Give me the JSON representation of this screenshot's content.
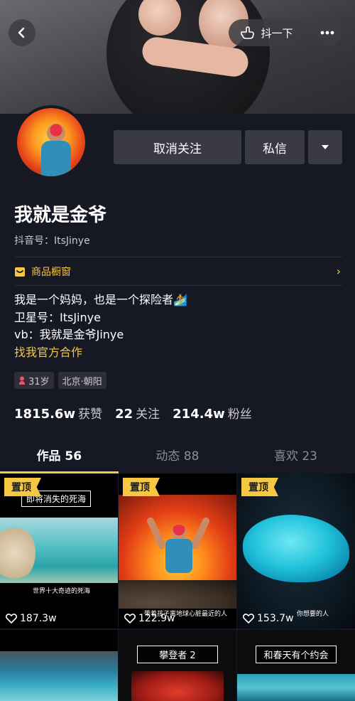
{
  "header": {
    "shake_label": "抖一下"
  },
  "profile": {
    "name": "我就是金爷",
    "douyin_id": "抖音号：ItsJinye",
    "unfollow_label": "取消关注",
    "message_label": "私信"
  },
  "shop": {
    "label": "商品橱窗"
  },
  "bio": {
    "line1": "我是一个妈妈，也是一个探险者🏄",
    "line2": "卫星号：ItsJinye",
    "line3": "vb：我就是金爷Jinye",
    "link": "找我官方合作"
  },
  "tags": {
    "age": "31岁",
    "location": "北京·朝阳"
  },
  "stats": {
    "likes_num": "1815.6w",
    "likes_label": "获赞",
    "following_num": "22",
    "following_label": "关注",
    "followers_num": "214.4w",
    "followers_label": "粉丝"
  },
  "tabs": [
    {
      "label": "作品 56"
    },
    {
      "label": "动态 88"
    },
    {
      "label": "喜欢 23"
    }
  ],
  "videos": [
    {
      "pinned": "置顶",
      "caption": "即将消失的死海",
      "sub": "世界十大奇迹的死海",
      "likes": "187.3w"
    },
    {
      "pinned": "置顶",
      "sub": "带着孩子离地球心脏最近的人",
      "likes": "122.9w"
    },
    {
      "pinned": "置顶",
      "sub": "你想要的人",
      "likes": "153.7w"
    },
    {
      "caption": ""
    },
    {
      "caption": "攀登者 2"
    },
    {
      "caption": "和春天有个约会"
    }
  ],
  "colors": {
    "background": "#161823",
    "accent": "#f5c743",
    "button": "#3a3a45"
  }
}
